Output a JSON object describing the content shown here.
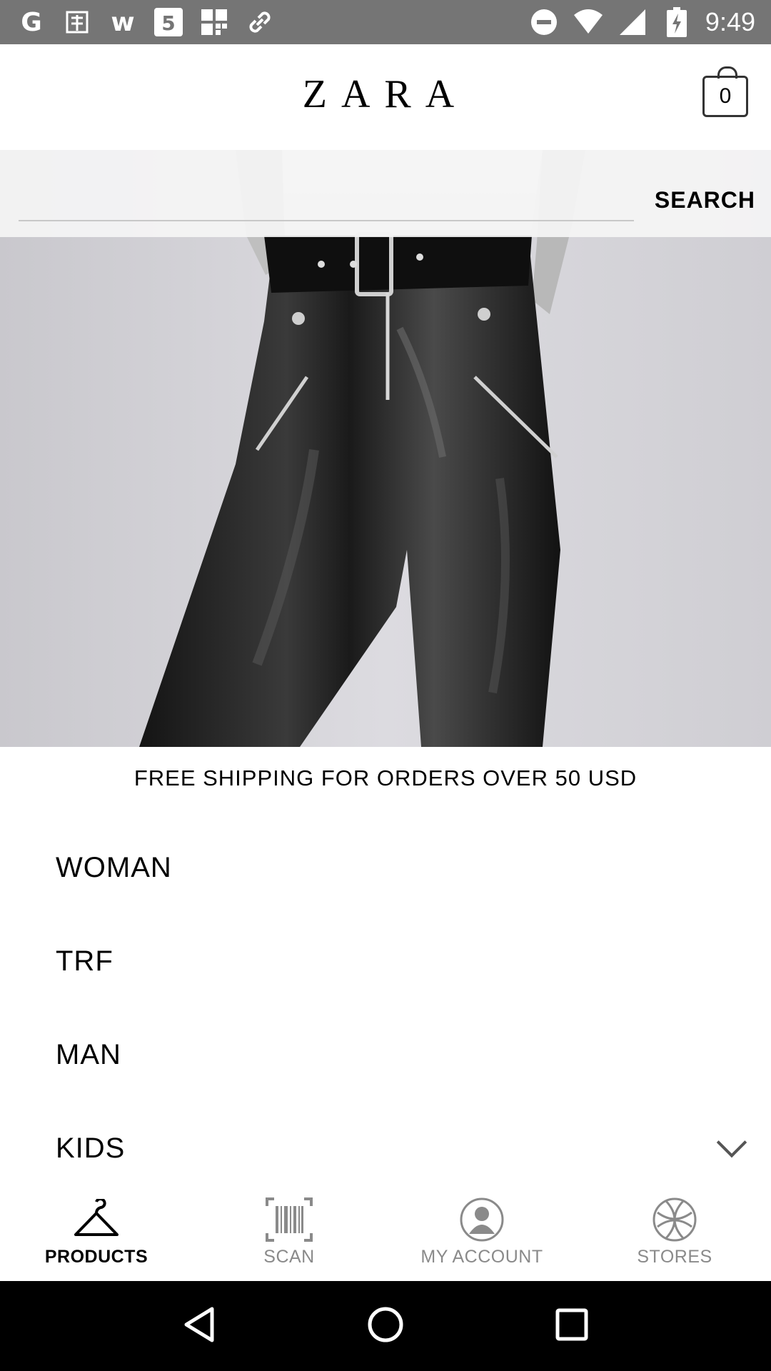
{
  "status_bar": {
    "time": "9:49",
    "notification_icons": [
      "g-icon",
      "taobao-icon",
      "w-icon",
      "html5-icon",
      "grid-icon",
      "link-icon"
    ],
    "system_icons": [
      "dnd-icon",
      "wifi-icon",
      "signal-icon",
      "battery-icon"
    ]
  },
  "header": {
    "logo": "ZARA",
    "cart_count": "0"
  },
  "search": {
    "value": "",
    "label": "SEARCH"
  },
  "promo": {
    "text": "FREE SHIPPING FOR ORDERS OVER 50 USD"
  },
  "menu": {
    "items": [
      {
        "label": "WOMAN"
      },
      {
        "label": "TRF"
      },
      {
        "label": "MAN"
      },
      {
        "label": "KIDS"
      }
    ]
  },
  "bottom_nav": {
    "items": [
      {
        "label": "PRODUCTS",
        "icon": "hanger-icon",
        "active": true
      },
      {
        "label": "SCAN",
        "icon": "barcode-icon",
        "active": false
      },
      {
        "label": "MY ACCOUNT",
        "icon": "account-icon",
        "active": false
      },
      {
        "label": "STORES",
        "icon": "globe-icon",
        "active": false
      }
    ]
  },
  "colors": {
    "status_bar": "#757575",
    "inactive_nav": "#8a8a8a",
    "active_nav": "#000000",
    "system_nav": "#000000"
  }
}
